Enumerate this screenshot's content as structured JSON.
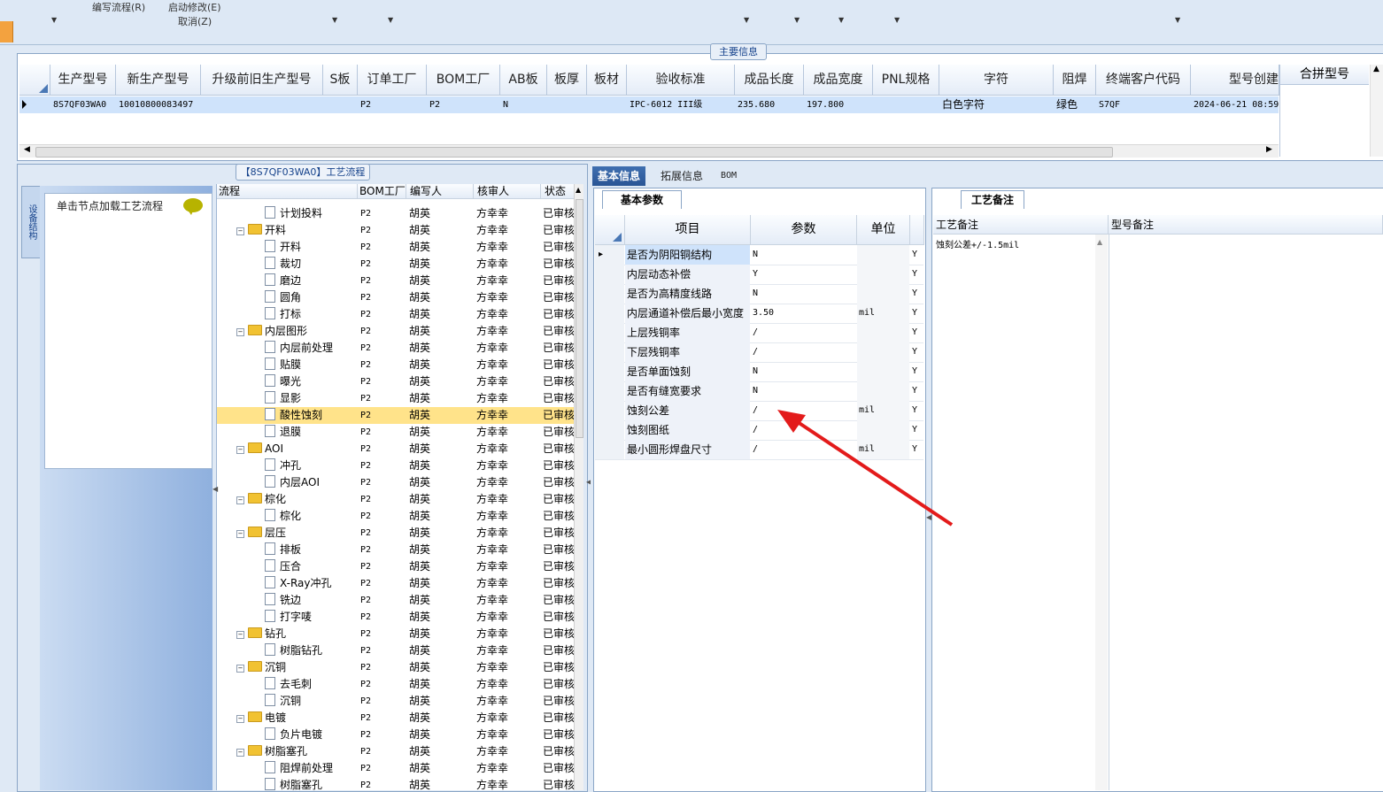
{
  "toolbar": {
    "items": [
      "编写流程(R)",
      "启动修改(E)",
      "取消(Z)"
    ]
  },
  "main_info": {
    "label": "主要信息",
    "columns": [
      "生产型号",
      "新生产型号",
      "升级前旧生产型号",
      "S板",
      "订单工厂",
      "BOM工厂",
      "AB板",
      "板厚",
      "板材",
      "验收标准",
      "成品长度",
      "成品宽度",
      "PNL规格",
      "字符",
      "阻焊",
      "终端客户代码",
      "型号创建"
    ],
    "merge_column": "合拼型号",
    "row": [
      "8S7QF03WA0",
      "10010800083497",
      "",
      "",
      "P2",
      "P2",
      "N",
      "",
      "",
      "IPC-6012 III级",
      "235.680",
      "197.800",
      "",
      "白色字符",
      "绿色",
      "S7QF",
      "2024-06-21 08:59"
    ]
  },
  "flow": {
    "title": "【8S7QF03WA0】工艺流程",
    "side_tab": "设备结构",
    "node_hint": "单击节点加载工艺流程",
    "columns": [
      "流程",
      "BOM工厂",
      "编写人",
      "核审人",
      "状态"
    ],
    "rows": [
      {
        "name": "计划投料",
        "level": 2,
        "factory": "P2",
        "author": "胡英",
        "reviewer": "方幸幸",
        "status": "已审核"
      },
      {
        "name": "开料",
        "level": 1,
        "factory": "P2",
        "author": "胡英",
        "reviewer": "方幸幸",
        "status": "已审核"
      },
      {
        "name": "开料",
        "level": 2,
        "factory": "P2",
        "author": "胡英",
        "reviewer": "方幸幸",
        "status": "已审核"
      },
      {
        "name": "裁切",
        "level": 2,
        "factory": "P2",
        "author": "胡英",
        "reviewer": "方幸幸",
        "status": "已审核"
      },
      {
        "name": "磨边",
        "level": 2,
        "factory": "P2",
        "author": "胡英",
        "reviewer": "方幸幸",
        "status": "已审核"
      },
      {
        "name": "圆角",
        "level": 2,
        "factory": "P2",
        "author": "胡英",
        "reviewer": "方幸幸",
        "status": "已审核"
      },
      {
        "name": "打标",
        "level": 2,
        "factory": "P2",
        "author": "胡英",
        "reviewer": "方幸幸",
        "status": "已审核"
      },
      {
        "name": "内层图形",
        "level": 1,
        "factory": "P2",
        "author": "胡英",
        "reviewer": "方幸幸",
        "status": "已审核"
      },
      {
        "name": "内层前处理",
        "level": 2,
        "factory": "P2",
        "author": "胡英",
        "reviewer": "方幸幸",
        "status": "已审核"
      },
      {
        "name": "贴膜",
        "level": 2,
        "factory": "P2",
        "author": "胡英",
        "reviewer": "方幸幸",
        "status": "已审核"
      },
      {
        "name": "曝光",
        "level": 2,
        "factory": "P2",
        "author": "胡英",
        "reviewer": "方幸幸",
        "status": "已审核"
      },
      {
        "name": "显影",
        "level": 2,
        "factory": "P2",
        "author": "胡英",
        "reviewer": "方幸幸",
        "status": "已审核"
      },
      {
        "name": "酸性蚀刻",
        "level": 2,
        "factory": "P2",
        "author": "胡英",
        "reviewer": "方幸幸",
        "status": "已审核",
        "selected": true
      },
      {
        "name": "退膜",
        "level": 2,
        "factory": "P2",
        "author": "胡英",
        "reviewer": "方幸幸",
        "status": "已审核"
      },
      {
        "name": "AOI",
        "level": 1,
        "factory": "P2",
        "author": "胡英",
        "reviewer": "方幸幸",
        "status": "已审核"
      },
      {
        "name": "冲孔",
        "level": 2,
        "factory": "P2",
        "author": "胡英",
        "reviewer": "方幸幸",
        "status": "已审核"
      },
      {
        "name": "内层AOI",
        "level": 2,
        "factory": "P2",
        "author": "胡英",
        "reviewer": "方幸幸",
        "status": "已审核"
      },
      {
        "name": "棕化",
        "level": 1,
        "factory": "P2",
        "author": "胡英",
        "reviewer": "方幸幸",
        "status": "已审核"
      },
      {
        "name": "棕化",
        "level": 2,
        "factory": "P2",
        "author": "胡英",
        "reviewer": "方幸幸",
        "status": "已审核"
      },
      {
        "name": "层压",
        "level": 1,
        "factory": "P2",
        "author": "胡英",
        "reviewer": "方幸幸",
        "status": "已审核"
      },
      {
        "name": "排板",
        "level": 2,
        "factory": "P2",
        "author": "胡英",
        "reviewer": "方幸幸",
        "status": "已审核"
      },
      {
        "name": "压合",
        "level": 2,
        "factory": "P2",
        "author": "胡英",
        "reviewer": "方幸幸",
        "status": "已审核"
      },
      {
        "name": "X-Ray冲孔",
        "level": 2,
        "factory": "P2",
        "author": "胡英",
        "reviewer": "方幸幸",
        "status": "已审核"
      },
      {
        "name": "铣边",
        "level": 2,
        "factory": "P2",
        "author": "胡英",
        "reviewer": "方幸幸",
        "status": "已审核"
      },
      {
        "name": "打字唛",
        "level": 2,
        "factory": "P2",
        "author": "胡英",
        "reviewer": "方幸幸",
        "status": "已审核"
      },
      {
        "name": "钻孔",
        "level": 1,
        "factory": "P2",
        "author": "胡英",
        "reviewer": "方幸幸",
        "status": "已审核"
      },
      {
        "name": "树脂钻孔",
        "level": 2,
        "factory": "P2",
        "author": "胡英",
        "reviewer": "方幸幸",
        "status": "已审核"
      },
      {
        "name": "沉铜",
        "level": 1,
        "factory": "P2",
        "author": "胡英",
        "reviewer": "方幸幸",
        "status": "已审核"
      },
      {
        "name": "去毛刺",
        "level": 2,
        "factory": "P2",
        "author": "胡英",
        "reviewer": "方幸幸",
        "status": "已审核"
      },
      {
        "name": "沉铜",
        "level": 2,
        "factory": "P2",
        "author": "胡英",
        "reviewer": "方幸幸",
        "status": "已审核"
      },
      {
        "name": "电镀",
        "level": 1,
        "factory": "P2",
        "author": "胡英",
        "reviewer": "方幸幸",
        "status": "已审核"
      },
      {
        "name": "负片电镀",
        "level": 2,
        "factory": "P2",
        "author": "胡英",
        "reviewer": "方幸幸",
        "status": "已审核"
      },
      {
        "name": "树脂塞孔",
        "level": 1,
        "factory": "P2",
        "author": "胡英",
        "reviewer": "方幸幸",
        "status": "已审核"
      },
      {
        "name": "阻焊前处理",
        "level": 2,
        "factory": "P2",
        "author": "胡英",
        "reviewer": "方幸幸",
        "status": "已审核"
      },
      {
        "name": "树脂塞孔",
        "level": 2,
        "factory": "P2",
        "author": "胡英",
        "reviewer": "方幸幸",
        "status": "已审核"
      }
    ]
  },
  "tabs": [
    "基本信息",
    "拓展信息",
    "BOM"
  ],
  "params": {
    "tab_label": "基本参数",
    "columns": [
      "项目",
      "参数",
      "单位"
    ],
    "rows": [
      {
        "item": "是否为阴阳铜结构",
        "value": "N",
        "unit": "",
        "flag": "Y"
      },
      {
        "item": "内层动态补偿",
        "value": "Y",
        "unit": "",
        "flag": "Y"
      },
      {
        "item": "是否为高精度线路",
        "value": "N",
        "unit": "",
        "flag": "Y"
      },
      {
        "item": "内层通道补偿后最小宽度",
        "value": "3.50",
        "unit": "mil",
        "flag": "Y"
      },
      {
        "item": "上层残铜率",
        "value": "/",
        "unit": "",
        "flag": "Y"
      },
      {
        "item": "下层残铜率",
        "value": "/",
        "unit": "",
        "flag": "Y"
      },
      {
        "item": "是否单面蚀刻",
        "value": "N",
        "unit": "",
        "flag": "Y"
      },
      {
        "item": "是否有缝宽要求",
        "value": "N",
        "unit": "",
        "flag": "Y"
      },
      {
        "item": "蚀刻公差",
        "value": "/",
        "unit": "mil",
        "flag": "Y"
      },
      {
        "item": "蚀刻图纸",
        "value": "/",
        "unit": "",
        "flag": "Y"
      },
      {
        "item": "最小圆形焊盘尺寸",
        "value": "/",
        "unit": "mil",
        "flag": "Y"
      }
    ]
  },
  "notes": {
    "tab_label": "工艺备注",
    "columns": [
      "工艺备注",
      "型号备注"
    ],
    "process_note": "蚀刻公差+/-1.5mil"
  },
  "colors": {
    "selection": "#cfe3fb",
    "highlight_row": "#ffe38a",
    "annotation_arrow": "#e31b1b"
  }
}
